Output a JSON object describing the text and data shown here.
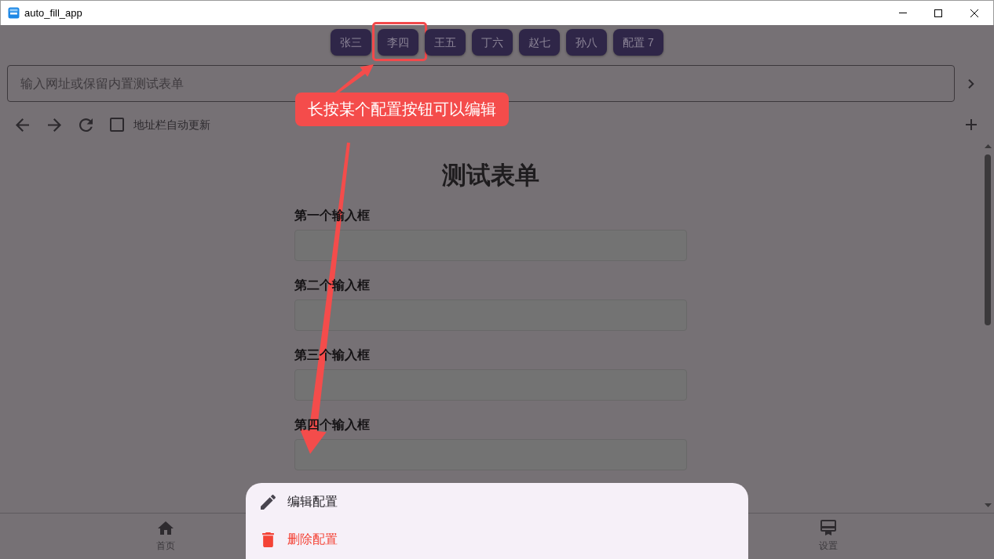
{
  "window": {
    "title": "auto_fill_app"
  },
  "profiles": [
    {
      "label": "张三",
      "highlighted": false
    },
    {
      "label": "李四",
      "highlighted": true
    },
    {
      "label": "王五",
      "highlighted": false
    },
    {
      "label": "丁六",
      "highlighted": false
    },
    {
      "label": "赵七",
      "highlighted": false
    },
    {
      "label": "孙八",
      "highlighted": false
    },
    {
      "label": "配置 7",
      "highlighted": false
    }
  ],
  "url_bar": {
    "placeholder": "输入网址或保留内置测试表单"
  },
  "toolbar": {
    "auto_update": {
      "label": "地址栏自动更新",
      "checked": false
    }
  },
  "form": {
    "title": "测试表单",
    "fields": [
      {
        "label": "第一个输入框"
      },
      {
        "label": "第二个输入框"
      },
      {
        "label": "第三个输入框"
      },
      {
        "label": "第四个输入框"
      }
    ]
  },
  "bottom_nav": [
    {
      "label": "首页",
      "kind": "home"
    },
    {
      "label": "设置",
      "kind": "settings"
    }
  ],
  "sheet": {
    "items": [
      {
        "label": "编辑配置",
        "kind": "edit"
      },
      {
        "label": "删除配置",
        "kind": "delete"
      }
    ]
  },
  "annotation": {
    "text": "长按某个配置按钮可以编辑"
  }
}
